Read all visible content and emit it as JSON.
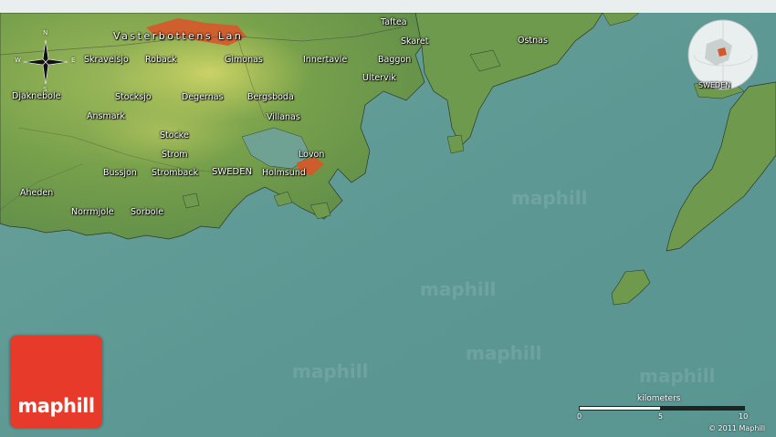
{
  "map": {
    "region_label": "Vasterbottens Lan",
    "country_label": "SWEDEN",
    "places": [
      {
        "name": "Taftea"
      },
      {
        "name": "Skaret"
      },
      {
        "name": "Ostnas"
      },
      {
        "name": "Skravelsjo"
      },
      {
        "name": "Roback"
      },
      {
        "name": "Gimonas"
      },
      {
        "name": "Innertavle"
      },
      {
        "name": "Baggon"
      },
      {
        "name": "Ultervik"
      },
      {
        "name": "Djaknebole"
      },
      {
        "name": "Stocksjo"
      },
      {
        "name": "Degernas"
      },
      {
        "name": "Bergsboda"
      },
      {
        "name": "Ansmark"
      },
      {
        "name": "Villanas"
      },
      {
        "name": "Stocke"
      },
      {
        "name": "Lovon"
      },
      {
        "name": "Strom"
      },
      {
        "name": "Bussjon"
      },
      {
        "name": "Stromback"
      },
      {
        "name": "Holmsund"
      },
      {
        "name": "Aheden"
      },
      {
        "name": "Norrmjole"
      },
      {
        "name": "Sorbole"
      }
    ],
    "globe_label": "SWEDEN",
    "compass": {
      "n": "N",
      "s": "S",
      "e": "E",
      "w": "W"
    },
    "watermarks": [
      "maphill",
      "maphill",
      "maphill",
      "maphill",
      "maphill"
    ]
  },
  "logo": {
    "text": "maphill"
  },
  "scale": {
    "title": "kilometers",
    "ticks": [
      "0",
      "5",
      "10"
    ]
  },
  "copyright": "© 2011 Maphill",
  "colors": {
    "sea": "#5f9a96",
    "land": "#6f9a4e",
    "urban": "#d8572a",
    "logo": "#e73a2b"
  }
}
